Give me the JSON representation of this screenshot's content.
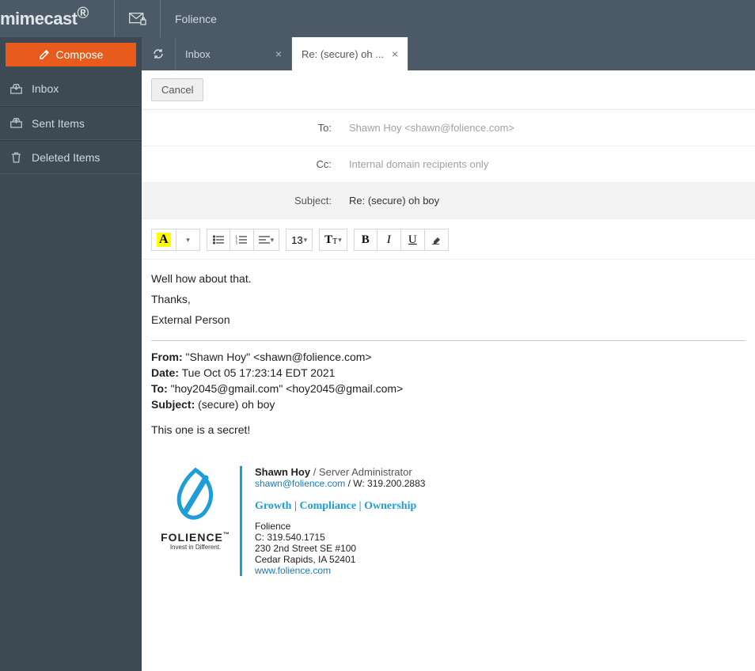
{
  "brand": "mimecast",
  "app_name": "Folience",
  "compose_label": "Compose",
  "sidebar": {
    "items": [
      {
        "label": "Inbox"
      },
      {
        "label": "Sent Items"
      },
      {
        "label": "Deleted Items"
      }
    ]
  },
  "tabs": {
    "inbox": {
      "label": "Inbox"
    },
    "active": {
      "label": "Re: (secure) oh ..."
    }
  },
  "buttons": {
    "cancel": "Cancel"
  },
  "fields": {
    "to_label": "To:",
    "to_value": "Shawn Hoy <shawn@folience.com>",
    "cc_label": "Cc:",
    "cc_placeholder": "Internal domain recipients only",
    "subject_label": "Subject:",
    "subject_value": "Re: (secure) oh boy"
  },
  "toolbar": {
    "font_letter": "A",
    "size": "13",
    "heading": "T",
    "bold": "B",
    "italic": "I",
    "underline": "U"
  },
  "body": {
    "line1": "Well how about that.",
    "line2": "Thanks,",
    "line3": "External Person"
  },
  "quoted": {
    "from_label": "From:",
    "from_value": " \"Shawn Hoy\" <shawn@folience.com>",
    "date_label": "Date:",
    "date_value": " Tue Oct 05 17:23:14 EDT 2021",
    "to_label": "To:",
    "to_value": " \"hoy2045@gmail.com\" <hoy2045@gmail.com>",
    "subject_label": "Subject:",
    "subject_value": " (secure) oh boy",
    "body": "This one is a secret!"
  },
  "signature": {
    "logo_name": "FOLIENCE",
    "logo_tm": "™",
    "logo_tag": "Invest in Different.",
    "name": "Shawn Hoy",
    "title_sep": " / ",
    "title": "Server Administrator",
    "email": "shawn@folience.com",
    "phone_sep": " / W: ",
    "phone": "319.200.2883",
    "tagline": "Growth  |  Compliance  |  Ownership",
    "company": "Folience",
    "cell": "C: 319.540.1715",
    "addr1": "230 2nd Street SE #100",
    "addr2": "Cedar Rapids, IA 52401",
    "web": "www.folience.com"
  }
}
